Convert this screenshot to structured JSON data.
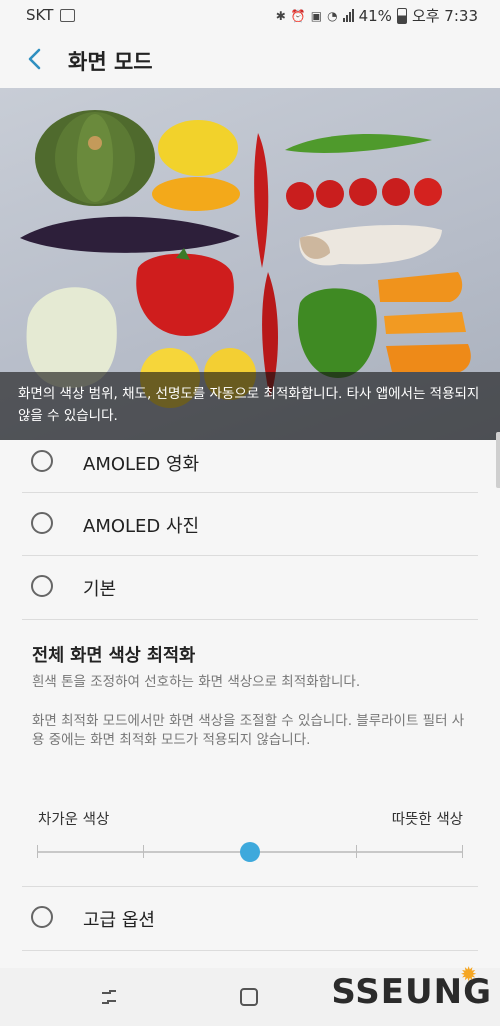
{
  "status_bar": {
    "carrier": "SKT",
    "battery": "41%",
    "time": "오후 7:33"
  },
  "header": {
    "title": "화면 모드"
  },
  "hero": {
    "caption": "화면의 색상 범위, 채도, 선명도를 자동으로 최적화합니다. 타사 앱에서는 적용되지 않을 수 있습니다."
  },
  "modes": [
    {
      "label": "AMOLED 영화",
      "selected": false
    },
    {
      "label": "AMOLED 사진",
      "selected": false
    },
    {
      "label": "기본",
      "selected": false
    }
  ],
  "optimize": {
    "title": "전체 화면 색상 최적화",
    "desc": "흰색 톤을 조정하여 선호하는 화면 색상으로 최적화합니다.",
    "note": "화면 최적화 모드에서만 화면 색상을 조절할 수 있습니다. 블루라이트 필터 사용 중에는 화면 최적화 모드가 적용되지 않습니다."
  },
  "slider": {
    "cool_label": "차가운 색상",
    "warm_label": "따뜻한 색상",
    "steps": 5,
    "value_index": 2
  },
  "advanced": {
    "label": "고급 옵션",
    "selected": false
  },
  "watermark": "SSEUNG",
  "colors": {
    "accent": "#3ea9dc",
    "background": "#f6f6f6"
  }
}
